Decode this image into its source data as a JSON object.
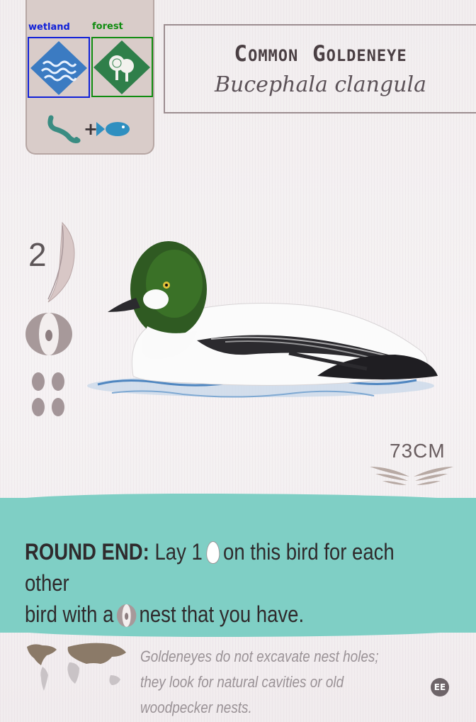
{
  "habitats": {
    "wetland_label": "wetland",
    "forest_label": "forest",
    "wetland_color": "#3b7bc2",
    "forest_color": "#2f7f4a",
    "wetland_icon": "waves-icon",
    "forest_icon": "trees-icon"
  },
  "food": {
    "items": [
      "invertebrate-worm-icon",
      "fish-icon"
    ],
    "separator": "+"
  },
  "bird": {
    "common_name": "Common Goldeneye",
    "scientific_name": "Bucephala clangula"
  },
  "stats": {
    "points": "2",
    "nest_type": "cavity-nest-icon",
    "egg_capacity": 4,
    "wingspan": "73CM"
  },
  "power": {
    "label": "ROUND END:",
    "text_1": "Lay 1",
    "text_2": "on this bird for each other",
    "text_3": "bird with a",
    "text_4": "nest that you have.",
    "band_color": "#7fcfc5"
  },
  "flavor": {
    "text": "Goldeneyes do not excavate nest holes; they look for natural cavities or old woodpecker nests."
  },
  "expansion_badge": "EE"
}
